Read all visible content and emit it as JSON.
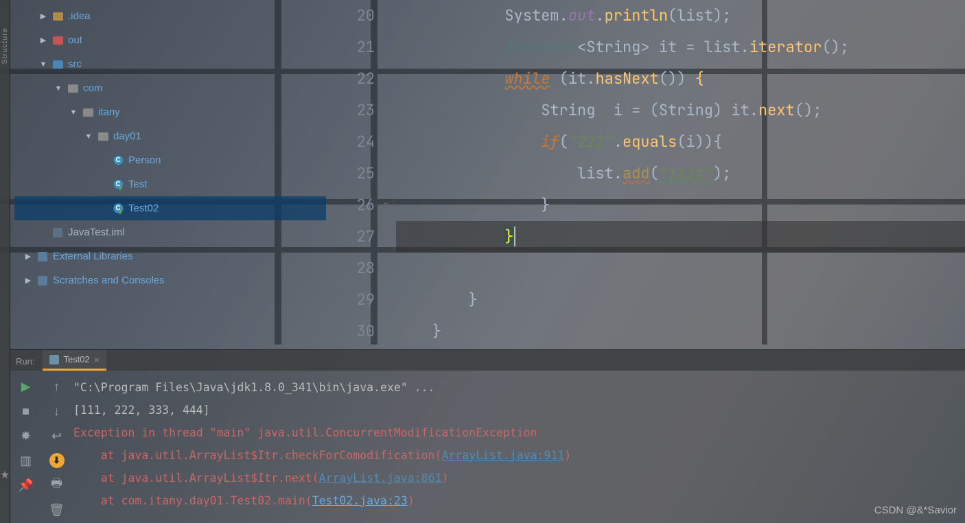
{
  "leftbar": {
    "label": "Structure",
    "fav": "Favorites"
  },
  "tree": {
    "items": [
      {
        "indent": 1,
        "arrow": "▶",
        "icon": "folder-d",
        "label": ".idea"
      },
      {
        "indent": 1,
        "arrow": "▶",
        "icon": "folder-o",
        "label": "out"
      },
      {
        "indent": 1,
        "arrow": "▼",
        "icon": "folder-s",
        "label": "src"
      },
      {
        "indent": 2,
        "arrow": "▼",
        "icon": "folder-p",
        "label": "com"
      },
      {
        "indent": 3,
        "arrow": "▼",
        "icon": "folder-p",
        "label": "itany"
      },
      {
        "indent": 4,
        "arrow": "▼",
        "icon": "folder-p",
        "label": "day01"
      },
      {
        "indent": 5,
        "arrow": "",
        "icon": "cls",
        "label": "Person"
      },
      {
        "indent": 5,
        "arrow": "",
        "icon": "cls r",
        "label": "Test"
      },
      {
        "indent": 5,
        "arrow": "",
        "icon": "cls r",
        "label": "Test02",
        "sel": true
      },
      {
        "indent": 1,
        "arrow": "",
        "icon": "iml",
        "label": "JavaTest.iml",
        "muted": true
      },
      {
        "indent": 0,
        "arrow": "▶",
        "icon": "lib",
        "label": "External Libraries"
      },
      {
        "indent": 0,
        "arrow": "▶",
        "icon": "lib",
        "label": "Scratches and Consoles"
      }
    ]
  },
  "editor": {
    "first_line": 20,
    "lines": [
      {
        "n": 20,
        "ind": 3,
        "tokens": [
          [
            "typ",
            "System"
          ],
          [
            "p",
            "."
          ],
          [
            "fld",
            "out"
          ],
          [
            "p",
            "."
          ],
          [
            "mth",
            "println"
          ],
          [
            "p",
            "("
          ],
          [
            "p",
            "list"
          ],
          [
            "p",
            ");"
          ]
        ]
      },
      {
        "n": 21,
        "ind": 3,
        "tokens": [
          [
            "gen",
            "Iterator"
          ],
          [
            "p",
            "<"
          ],
          [
            "typ",
            "String"
          ],
          [
            "p",
            "> it = list."
          ],
          [
            "mth",
            "iterator"
          ],
          [
            "p",
            "();"
          ]
        ]
      },
      {
        "n": 22,
        "ind": 3,
        "tokens": [
          [
            "kw u",
            "while"
          ],
          [
            "p",
            " ("
          ],
          [
            "p",
            "it."
          ],
          [
            "mth",
            "hasNext"
          ],
          [
            "p",
            "()) "
          ],
          [
            "y",
            "{"
          ]
        ]
      },
      {
        "n": 23,
        "ind": 4,
        "tokens": [
          [
            "typ",
            "String"
          ],
          [
            "p",
            "  i = ("
          ],
          [
            "typ",
            "String"
          ],
          [
            "p",
            ") it."
          ],
          [
            "mth",
            "next"
          ],
          [
            "p",
            "();"
          ]
        ]
      },
      {
        "n": 24,
        "ind": 4,
        "tokens": [
          [
            "kw",
            "if"
          ],
          [
            "p",
            "("
          ],
          [
            "str",
            "\"222\""
          ],
          [
            "p",
            "."
          ],
          [
            "mth",
            "equals"
          ],
          [
            "p",
            "(i)){"
          ]
        ]
      },
      {
        "n": 25,
        "ind": 5,
        "tokens": [
          [
            "p",
            "list."
          ],
          [
            "mth u",
            "add"
          ],
          [
            "p",
            "("
          ],
          [
            "str u",
            "\"zzzz\""
          ],
          [
            "p",
            ");"
          ]
        ]
      },
      {
        "n": 26,
        "ind": 4,
        "tokens": [
          [
            "p",
            "}"
          ]
        ]
      },
      {
        "n": 27,
        "ind": 3,
        "hl": true,
        "tokens": [
          [
            "brace-match",
            "}"
          ]
        ]
      },
      {
        "n": 28,
        "ind": 0,
        "tokens": []
      },
      {
        "n": 29,
        "ind": 2,
        "tokens": [
          [
            "p",
            "}"
          ]
        ]
      },
      {
        "n": 30,
        "ind": 1,
        "tokens": [
          [
            "p",
            "}"
          ]
        ]
      }
    ]
  },
  "run": {
    "label": "Run:",
    "tab": "Test02",
    "lines": [
      {
        "cls": "",
        "txt": "\"C:\\Program Files\\Java\\jdk1.8.0_341\\bin\\java.exe\" ..."
      },
      {
        "cls": "",
        "txt": "[111, 222, 333, 444]"
      },
      {
        "cls": "err",
        "txt": "Exception in thread \"main\" java.util.ConcurrentModificationException"
      },
      {
        "cls": "st",
        "pre": "    at java.util.ArrayList$Itr.checkForComodification(",
        "link": "ArrayList.java:911",
        "post": ")"
      },
      {
        "cls": "st",
        "pre": "    at java.util.ArrayList$Itr.next(",
        "link": "ArrayList.java:861",
        "post": ")"
      },
      {
        "cls": "st",
        "pre": "    at com.itany.day01.Test02.main(",
        "link2": "Test02.java:23",
        "post": ")"
      }
    ]
  },
  "watermark": "CSDN @&*Savior"
}
